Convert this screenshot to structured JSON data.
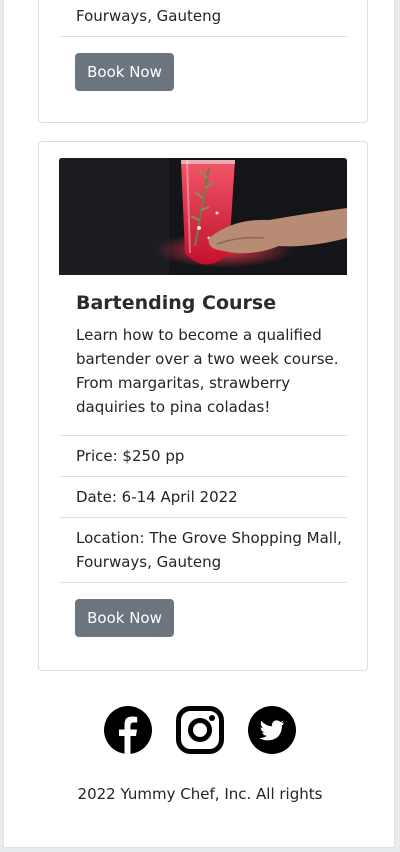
{
  "card_previous": {
    "location_tail": "Fourways, Gauteng",
    "button": "Book Now"
  },
  "card_course": {
    "title": "Bartending Course",
    "description": "Learn how to become a qualified bartender over a two week course. From margaritas, strawberry daquiries to pina coladas!",
    "price": "Price: $250 pp",
    "date": "Date: 6-14 April 2022",
    "location_line1": "Location: The Grove Shopping Mall,",
    "location_line2": "Fourways, Gauteng",
    "button": "Book Now"
  },
  "footer": {
    "social_icons": [
      "facebook-icon",
      "instagram-icon",
      "twitter-icon"
    ],
    "copyright": "2022 Yummy Chef, Inc. All rights"
  },
  "colors": {
    "button_bg": "#6c757d",
    "border": "#dcdcdc",
    "text": "#212529"
  }
}
